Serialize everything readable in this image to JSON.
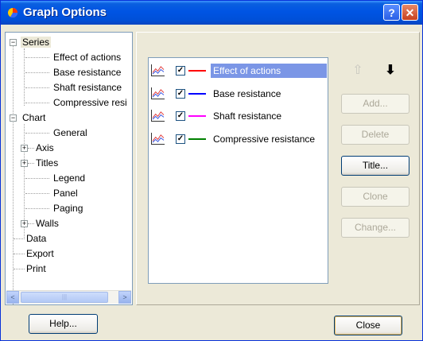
{
  "window": {
    "title": "Graph Options",
    "help_glyph": "?",
    "close_glyph": "✕"
  },
  "tree": {
    "items": [
      {
        "label": "Series",
        "selected": true,
        "expanded": true
      },
      {
        "label": "Effect of actions"
      },
      {
        "label": "Base resistance"
      },
      {
        "label": "Shaft resistance"
      },
      {
        "label": "Compressive resi"
      },
      {
        "label": "Chart",
        "expanded": true
      },
      {
        "label": "General"
      },
      {
        "label": "Axis",
        "collapsed": true
      },
      {
        "label": "Titles",
        "collapsed": true
      },
      {
        "label": "Legend"
      },
      {
        "label": "Panel"
      },
      {
        "label": "Paging"
      },
      {
        "label": "Walls",
        "collapsed": true
      },
      {
        "label": "Data"
      },
      {
        "label": "Export"
      },
      {
        "label": "Print"
      }
    ],
    "scroll_left": "<",
    "scroll_right": ">",
    "thumb_grip": "|||"
  },
  "series": [
    {
      "label": "Effect of actions",
      "color": "#ff0000",
      "checked": true,
      "selected": true
    },
    {
      "label": "Base resistance",
      "color": "#0000ff",
      "checked": true
    },
    {
      "label": "Shaft resistance",
      "color": "#ff00ff",
      "checked": true
    },
    {
      "label": "Compressive resistance",
      "color": "#008000",
      "checked": true
    }
  ],
  "check_glyph": "✓",
  "arrows": {
    "up": "⇧",
    "down": "⬇"
  },
  "buttons": {
    "add": "Add...",
    "delete": "Delete",
    "title": "Title...",
    "clone": "Clone",
    "change": "Change...",
    "help": "Help...",
    "close": "Close"
  }
}
